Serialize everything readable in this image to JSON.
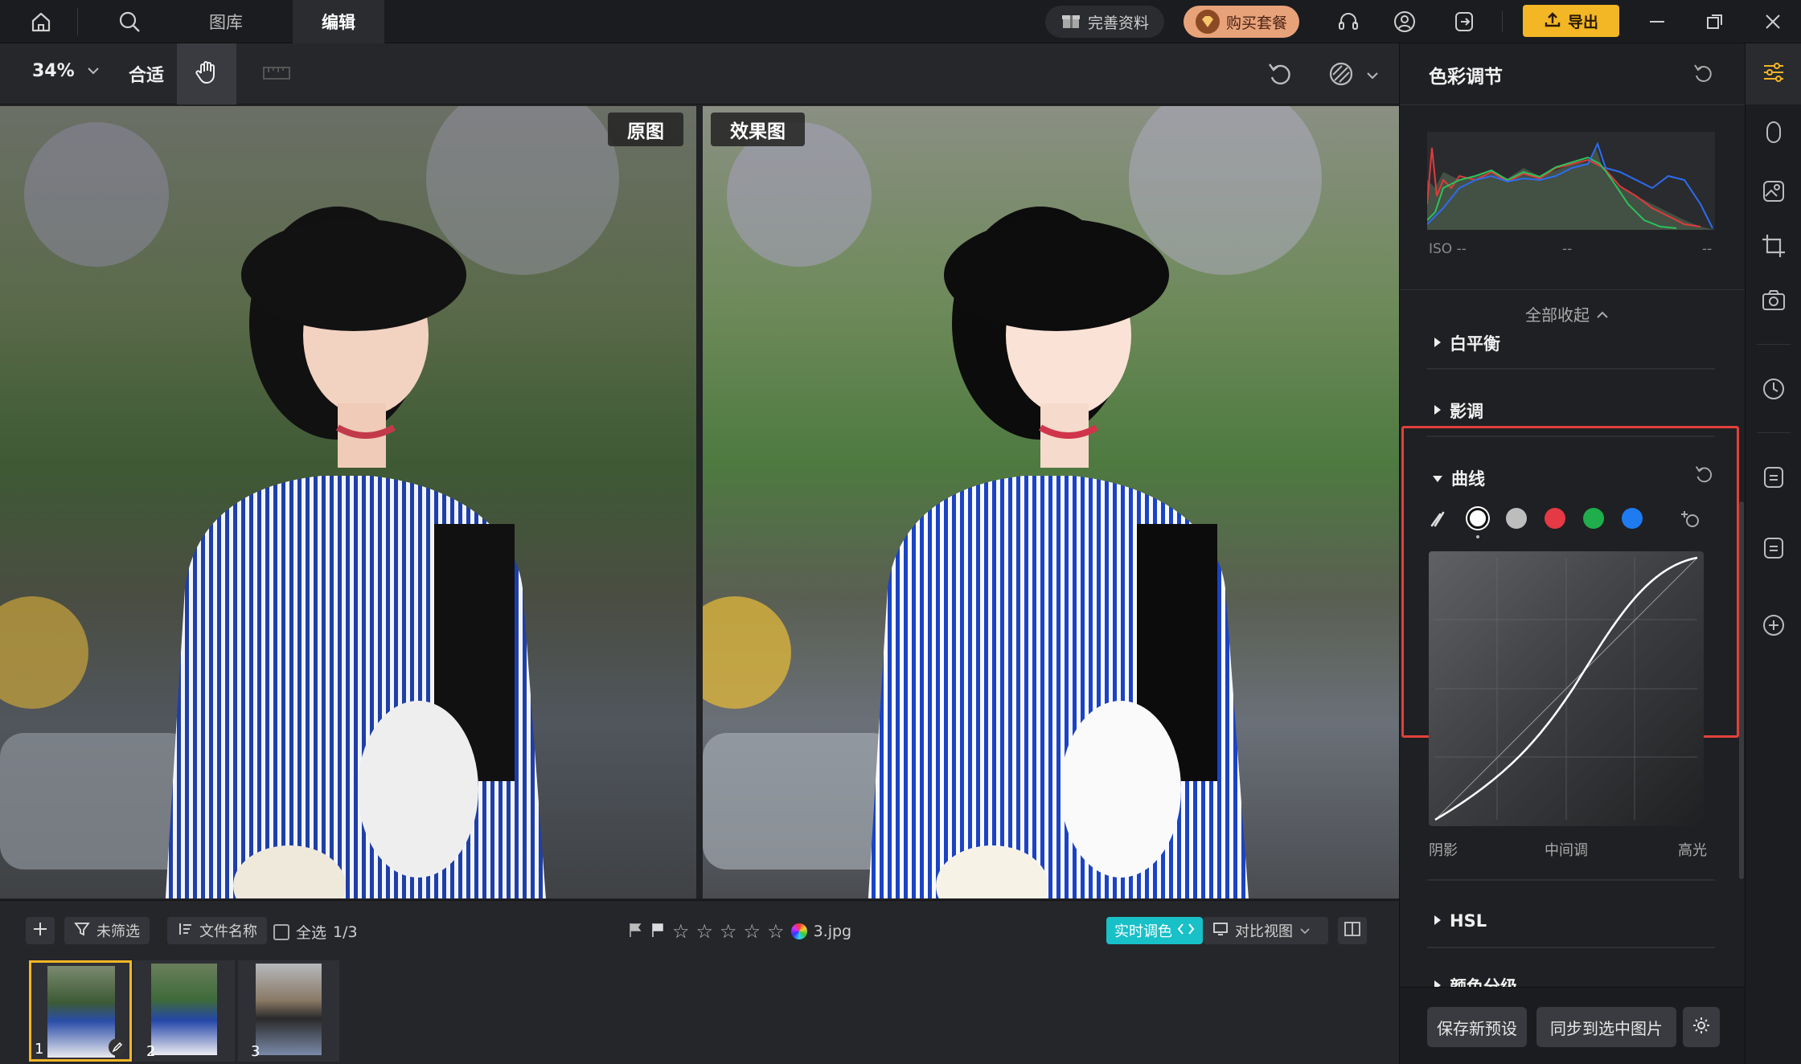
{
  "topbar": {
    "tabs": [
      "图库",
      "编辑"
    ],
    "profile_button": "完善资料",
    "buy_button": "购买套餐",
    "export_button": "导出"
  },
  "toolbar": {
    "zoom": "34%",
    "fit": "合适"
  },
  "canvas": {
    "original_label": "原图",
    "result_label": "效果图"
  },
  "bottombar": {
    "filter": "未筛选",
    "sort": "文件名称",
    "select_all": "全选",
    "count": "1/3",
    "filename": "3.jpg",
    "realtime_toggle": "实时调色",
    "compare_view": "对比视图",
    "thumbnails": [
      "1",
      "2",
      "3"
    ]
  },
  "panel": {
    "title": "色彩调节",
    "histogram": {
      "iso": "ISO --",
      "mid": "--",
      "right": "--"
    },
    "collapse_all": "全部收起",
    "sections": {
      "white_balance": "白平衡",
      "tone": "影调",
      "curve": "曲线",
      "hsl": "HSL",
      "color_grading": "颜色分级"
    },
    "curve_labels": {
      "shadow": "阴影",
      "midtone": "中间调",
      "highlight": "高光"
    },
    "channel_colors": {
      "gray": "#bdbdbd",
      "red": "#e53945",
      "green": "#1fae4b",
      "blue": "#1e7bf0"
    },
    "save_preset": "保存新预设",
    "sync": "同步到选中图片"
  },
  "colors": {
    "accent": "#f3b625",
    "teal": "#18c0c8",
    "highlight_box": "#e0413a"
  }
}
